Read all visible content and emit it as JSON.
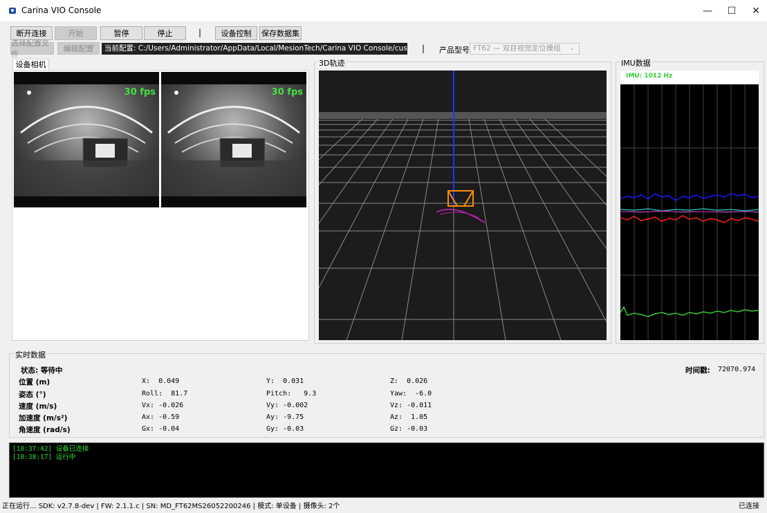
{
  "window": {
    "title": "Carina VIO Console"
  },
  "toolbar": {
    "disconnect": "断开连接",
    "start": "开始",
    "pause": "暂停",
    "stop": "停止",
    "separator": "|",
    "device_control": "设备控制",
    "save_dataset": "保存数据集"
  },
  "config_bar": {
    "select_config": "选择配置文件",
    "edit_config": "编辑配置",
    "current_config": "当前配置: C:/Users/Administrator/AppData/Local/MesionTech/Carina VIO Console/custom_config.yaml",
    "separator": "|",
    "product_label": "产品型号:",
    "product_value": "FT62 — 双目视觉定位模组"
  },
  "camera_panel": {
    "tab": "设备相机",
    "left_fps": "30 fps",
    "right_fps": "30 fps"
  },
  "trajectory_panel": {
    "title": "3D轨迹"
  },
  "imu_panel": {
    "title": "IMU数据",
    "rate": "IMU: 1012 Hz",
    "colors": {
      "blue": "#1a1aff",
      "red": "#ff2020",
      "green": "#33cc33",
      "cyan": "#33cccc",
      "magenta": "#cc33cc"
    }
  },
  "realtime": {
    "title": "实时数据",
    "status": "状态: 等待中",
    "timestamp_label": "时间戳:",
    "timestamp_value": "72070.974",
    "rows": [
      {
        "label": "位置 (m)",
        "c1": "X:  0.049",
        "c2": "Y:  0.031",
        "c3": "Z:  0.026"
      },
      {
        "label": "姿态 (°)",
        "c1": "Roll:  81.7",
        "c2": "Pitch:   9.3",
        "c3": "Yaw:  -6.0"
      },
      {
        "label": "速度 (m/s)",
        "c1": "Vx: -0.026",
        "c2": "Vy: -0.002",
        "c3": "Vz: -0.011"
      },
      {
        "label": "加速度 (m/s²)",
        "c1": "Ax: -0.59",
        "c2": "Ay: -9.75",
        "c3": "Az:  1.05"
      },
      {
        "label": "角速度 (rad/s)",
        "c1": "Gx: -0.04",
        "c2": "Gy: -0.03",
        "c3": "Gz: -0.03"
      }
    ]
  },
  "log": [
    "[10:37:42] 设备已连接",
    "[10:38:17] 运行中"
  ],
  "statusbar": {
    "text": "正在运行... SDK: v2.7.8-dev | FW: 2.1.1.c | SN: MD_FT62MS26052200246 | 模式: 单设备 | 摄像头: 2个",
    "connection": "已连接"
  }
}
